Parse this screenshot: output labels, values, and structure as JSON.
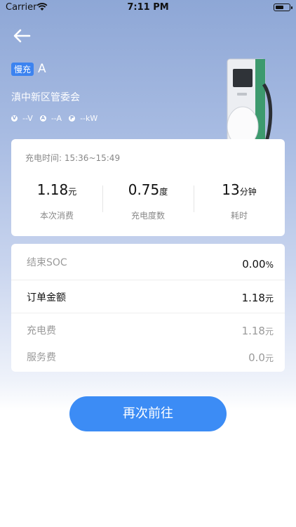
{
  "status_bar": {
    "carrier": "Carrier",
    "time": "7:11 PM"
  },
  "station": {
    "type_badge": "慢充",
    "code": "A",
    "name": "滇中新区管委会",
    "metrics": [
      {
        "icon": "voltage-icon",
        "glyph": "V",
        "text": "--V"
      },
      {
        "icon": "current-icon",
        "glyph": "A",
        "text": "--A"
      },
      {
        "icon": "power-icon",
        "glyph": "P",
        "text": "--kW"
      }
    ]
  },
  "session": {
    "period": "充电时间:  15:36~15:49",
    "stats": [
      {
        "value": "1.18",
        "unit": "元",
        "label": "本次消费"
      },
      {
        "value": "0.75",
        "unit": "度",
        "label": "充电度数"
      },
      {
        "value": "13",
        "unit": "分钟",
        "label": "耗时"
      }
    ]
  },
  "details": {
    "end_soc": {
      "label": "结束SOC",
      "value": "0.00",
      "unit": "%"
    },
    "order_amount": {
      "label": "订单金额",
      "value": "1.18",
      "unit": "元"
    },
    "charging_fee": {
      "label": "充电费",
      "value": "1.18",
      "unit": "元"
    },
    "service_fee": {
      "label": "服务费",
      "value": "0.0",
      "unit": "元"
    }
  },
  "action": {
    "go_again": "再次前往"
  }
}
